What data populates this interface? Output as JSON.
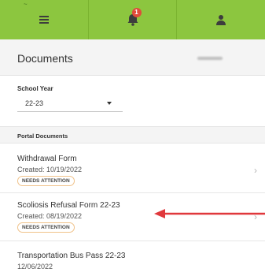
{
  "topbar": {
    "stub_text": "~",
    "notification_count": "1",
    "tabs": [
      "menu",
      "notifications",
      "profile"
    ],
    "color": "#8cc63f"
  },
  "header": {
    "title": "Documents"
  },
  "filter": {
    "label": "School Year",
    "selected": "22-23"
  },
  "section": {
    "label": "Portal Documents"
  },
  "documents": [
    {
      "name": "Withdrawal Form",
      "created": "Created: 10/19/2022",
      "status": "NEEDS ATTENTION"
    },
    {
      "name": "Scoliosis Refusal Form 22-23",
      "created": "Created: 08/19/2022",
      "status": "NEEDS ATTENTION"
    },
    {
      "name": "Transportation Bus Pass 22-23",
      "created": "12/06/2022",
      "status": ""
    }
  ],
  "colors": {
    "accent": "#8cc63f",
    "badge": "#e04b3a",
    "pill_border": "#f0c28a",
    "annotation_arrow": "#e0383c"
  }
}
